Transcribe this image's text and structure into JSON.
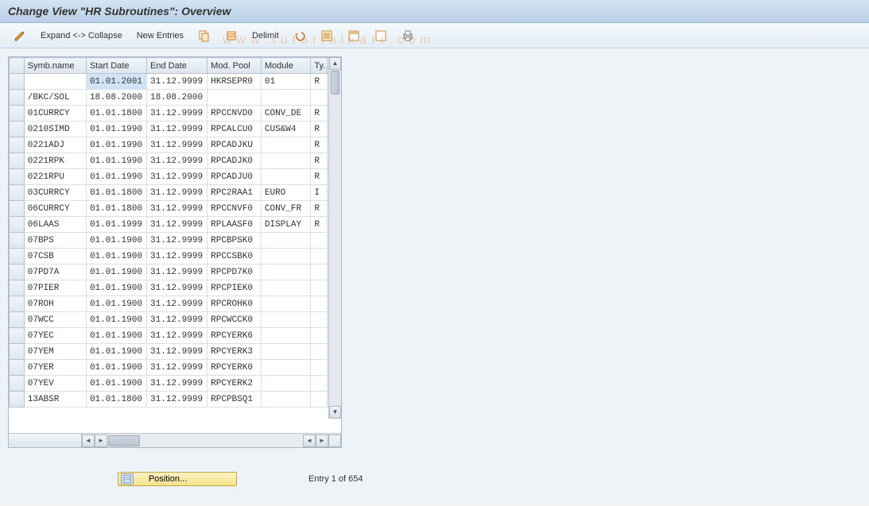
{
  "title": "Change View \"HR Subroutines\": Overview",
  "toolbar": {
    "expand_collapse": "Expand <-> Collapse",
    "new_entries": "New Entries",
    "delimit": "Delimit"
  },
  "columns": {
    "symb": "Symb.name",
    "start": "Start Date",
    "end": "End Date",
    "pool": "Mod. Pool",
    "module": "Module",
    "ty": "Ty."
  },
  "rows": [
    {
      "symb": "",
      "start": "01.01.2001",
      "end": "31.12.9999",
      "pool": "HKRSEPR0",
      "module": "01",
      "ty": "R"
    },
    {
      "symb": "/BKC/SOL",
      "start": "18.08.2000",
      "end": "18.08.2000",
      "pool": "",
      "module": "",
      "ty": ""
    },
    {
      "symb": "01CURRCY",
      "start": "01.01.1800",
      "end": "31.12.9999",
      "pool": "RPCCNVD0",
      "module": "CONV_DE",
      "ty": "R"
    },
    {
      "symb": "0210SIMD",
      "start": "01.01.1990",
      "end": "31.12.9999",
      "pool": "RPCALCU0",
      "module": "CUS&W4",
      "ty": "R"
    },
    {
      "symb": "0221ADJ",
      "start": "01.01.1990",
      "end": "31.12.9999",
      "pool": "RPCADJKU",
      "module": "",
      "ty": "R"
    },
    {
      "symb": "0221RPK",
      "start": "01.01.1990",
      "end": "31.12.9999",
      "pool": "RPCADJK0",
      "module": "",
      "ty": "R"
    },
    {
      "symb": "0221RPU",
      "start": "01.01.1990",
      "end": "31.12.9999",
      "pool": "RPCADJU0",
      "module": "",
      "ty": "R"
    },
    {
      "symb": "03CURRCY",
      "start": "01.01.1800",
      "end": "31.12.9999",
      "pool": "RPC2RAA1",
      "module": "EURO",
      "ty": "I"
    },
    {
      "symb": "06CURRCY",
      "start": "01.01.1800",
      "end": "31.12.9999",
      "pool": "RPCCNVF0",
      "module": "CONV_FR",
      "ty": "R"
    },
    {
      "symb": "06LAAS",
      "start": "01.01.1999",
      "end": "31.12.9999",
      "pool": "RPLAASF0",
      "module": "DISPLAY",
      "ty": "R"
    },
    {
      "symb": "07BPS",
      "start": "01.01.1900",
      "end": "31.12.9999",
      "pool": "RPCBPSK0",
      "module": "",
      "ty": ""
    },
    {
      "symb": "07CSB",
      "start": "01.01.1900",
      "end": "31.12.9999",
      "pool": "RPCCSBK0",
      "module": "",
      "ty": ""
    },
    {
      "symb": "07PD7A",
      "start": "01.01.1900",
      "end": "31.12.9999",
      "pool": "RPCPD7K0",
      "module": "",
      "ty": ""
    },
    {
      "symb": "07PIER",
      "start": "01.01.1900",
      "end": "31.12.9999",
      "pool": "RPCPIEK0",
      "module": "",
      "ty": ""
    },
    {
      "symb": "07ROH",
      "start": "01.01.1900",
      "end": "31.12.9999",
      "pool": "RPCROHK0",
      "module": "",
      "ty": ""
    },
    {
      "symb": "07WCC",
      "start": "01.01.1900",
      "end": "31.12.9999",
      "pool": "RPCWCCK0",
      "module": "",
      "ty": ""
    },
    {
      "symb": "07YEC",
      "start": "01.01.1900",
      "end": "31.12.9999",
      "pool": "RPCYERK6",
      "module": "",
      "ty": ""
    },
    {
      "symb": "07YEM",
      "start": "01.01.1900",
      "end": "31.12.9999",
      "pool": "RPCYERK3",
      "module": "",
      "ty": ""
    },
    {
      "symb": "07YER",
      "start": "01.01.1900",
      "end": "31.12.9999",
      "pool": "RPCYERK0",
      "module": "",
      "ty": ""
    },
    {
      "symb": "07YEV",
      "start": "01.01.1900",
      "end": "31.12.9999",
      "pool": "RPCYERK2",
      "module": "",
      "ty": ""
    },
    {
      "symb": "13ABSR",
      "start": "01.01.1800",
      "end": "31.12.9999",
      "pool": "RPCPBSQ1",
      "module": "",
      "ty": ""
    }
  ],
  "footer": {
    "position": "Position...",
    "entry": "Entry 1 of 654"
  },
  "watermark": "www.tutorialkart.com"
}
